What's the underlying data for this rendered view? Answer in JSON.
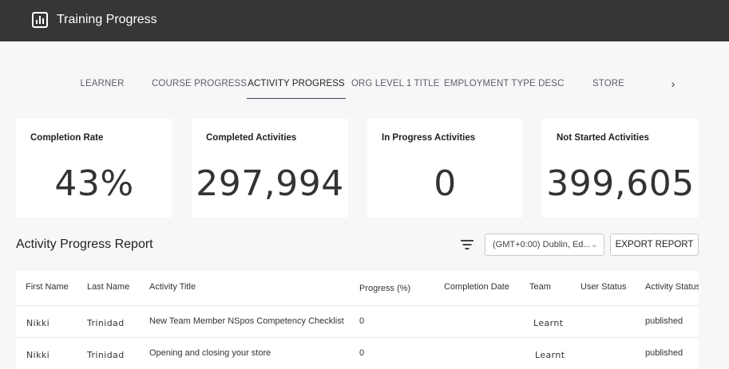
{
  "app": {
    "title": "Training Progress",
    "icon": "bar-chart-icon"
  },
  "tabs": [
    {
      "label": "LEARNER",
      "active": false
    },
    {
      "label": "COURSE PROGRESS",
      "active": false
    },
    {
      "label": "ACTIVITY PROGRESS",
      "active": true
    },
    {
      "label": "ORG LEVEL 1 TITLE",
      "active": false
    },
    {
      "label": "EMPLOYMENT TYPE DESC",
      "active": false
    },
    {
      "label": "STORE",
      "active": false
    }
  ],
  "tabs_next_glyph": "›",
  "stats": [
    {
      "title": "Completion Rate",
      "value": "43%"
    },
    {
      "title": "Completed Activities",
      "value": "297,994"
    },
    {
      "title": "In Progress Activities",
      "value": "0"
    },
    {
      "title": "Not Started Activities",
      "value": "399,605"
    }
  ],
  "report": {
    "title": "Activity Progress Report",
    "timezone_selected": "(GMT+0:00) Dublin, Ed...",
    "timezone_chevron": "⌄",
    "export_label": "EXPORT REPORT"
  },
  "table": {
    "columns": [
      "First Name",
      "Last Name",
      "Activity Title",
      "Progress (%)",
      "Completion Date",
      "Team",
      "User Status",
      "Activity Status"
    ],
    "rows": [
      [
        "Nikki",
        "Trinidad",
        "New Team Member NSpos Competency Checklist",
        "0",
        "",
        "Learnt",
        "",
        "published"
      ],
      [
        "Nikki",
        "Trinidad",
        "Opening and closing your store",
        "0",
        "",
        "Learnt",
        "",
        "published"
      ]
    ]
  },
  "colors": {
    "topbar": "#363636",
    "background": "#f7f7f8",
    "active_tab_underline": "#3b4154"
  }
}
